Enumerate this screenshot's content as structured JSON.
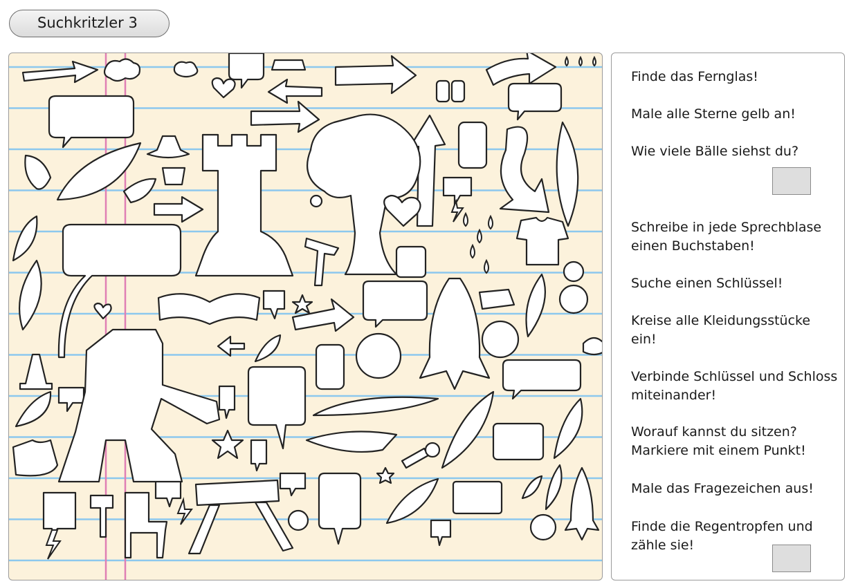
{
  "title": "Suchkritzler 3",
  "tasks": [
    "Finde das Fernglas!",
    "Male alle Sterne gelb an!",
    "Wie viele Bälle siehst du?",
    "Schreibe in jede Sprechblase einen Buchstaben!",
    "Suche einen Schlüssel!",
    "Kreise alle Kleidungsstücke ein!",
    "Verbinde Schlüssel und Schloss miteinander!",
    "Worauf kannst du sitzen? Markiere mit einem Punkt!",
    "Male das Fragezeichen aus!",
    "Finde die Regentropfen und zähle sie!"
  ],
  "colors": {
    "paper": "#fcf2dc",
    "ruled_line": "#8cc8ee",
    "margin_line": "#e07fb4",
    "answer_box": "#dedede"
  }
}
